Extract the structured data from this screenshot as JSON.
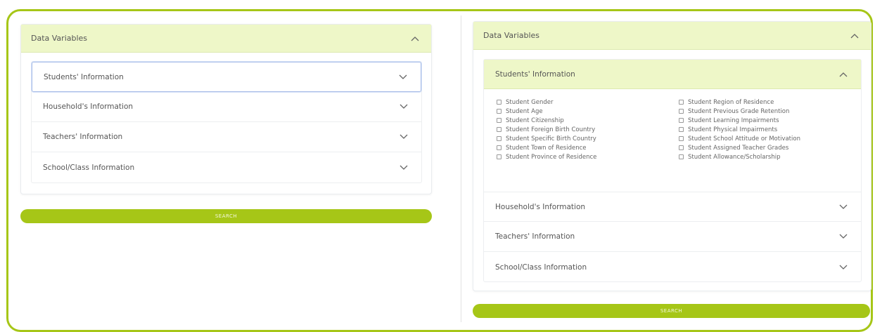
{
  "left": {
    "panel_title": "Data Variables",
    "rows": [
      {
        "label": "Students' Information"
      },
      {
        "label": "Household's Information"
      },
      {
        "label": "Teachers' Information"
      },
      {
        "label": "School/Class Information"
      }
    ],
    "search_label": "SEARCH"
  },
  "right": {
    "panel_title": "Data Variables",
    "expanded_section": "Students' Information",
    "options_col1": [
      "Student Gender",
      "Student Age",
      "Student Citizenship",
      "Student Foreign Birth Country",
      "Student Specific Birth Country",
      "Student Town of Residence",
      "Student Province of Residence"
    ],
    "options_col2": [
      "Student Region of Residence",
      "Student Previous Grade Retention",
      "Student Learning Impairments",
      "Student Physical Impairments",
      "Student School Attitude or Motivation",
      "Student Assigned Teacher Grades",
      "Student Allowance/Scholarship"
    ],
    "rows": [
      {
        "label": "Household's Information"
      },
      {
        "label": "Teachers' Information"
      },
      {
        "label": "School/Class Information"
      }
    ],
    "search_label": "SEARCH"
  },
  "colors": {
    "accent": "#a6c617",
    "header_bg": "#eef7c8"
  }
}
